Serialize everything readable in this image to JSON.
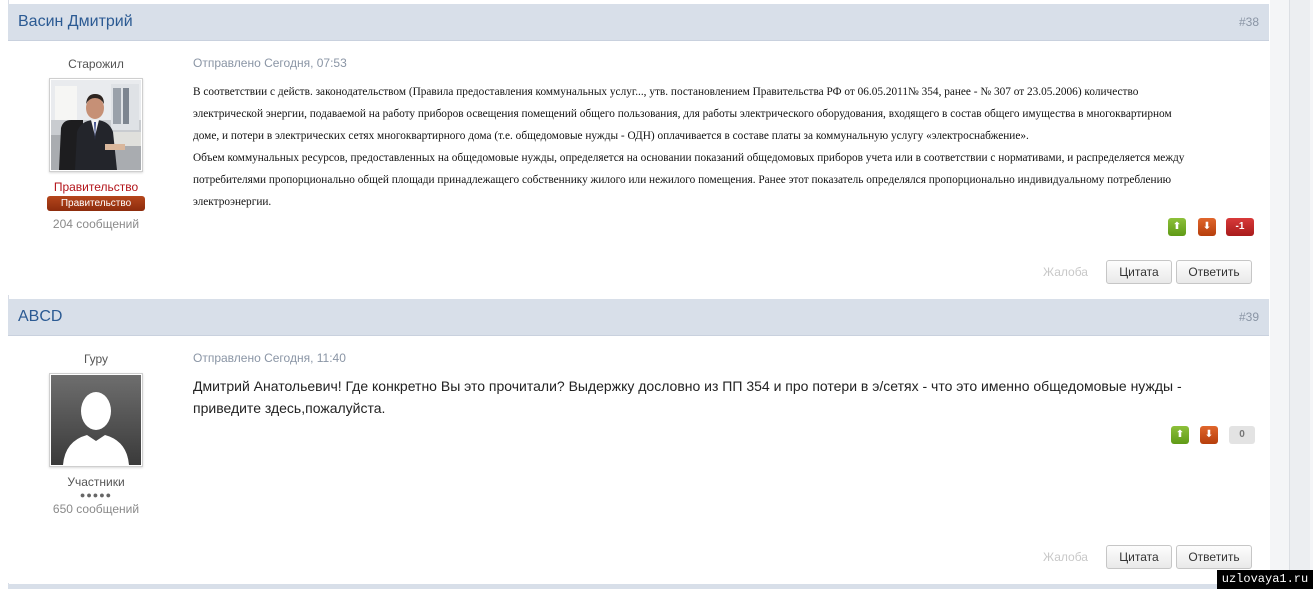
{
  "posts": [
    {
      "author": "Васин Дмитрий",
      "number": "#38",
      "rank_title": "Старожил",
      "group_name": "Правительство",
      "group_badge": "Правительство",
      "post_count": "204 сообщений",
      "date": "Отправлено Сегодня, 07:53",
      "body_lines": [
        "В соответствии с действ. законодательством  (Правила предоставления коммунальных услуг..., утв. постановлением Правительства РФ от 06.05.2011№ 354, ранее - № 307 от 23.05.2006) количество",
        "электрической энергии, подаваемой на работу приборов освещения помещений общего пользования, для работы электрического оборудования, входящего в состав общего имущества в многоквартирном",
        "доме, и потери в электрических сетях многоквартирного дома (т.е. общедомовые нужды - ОДН) оплачивается  в составе платы за коммунальную услугу «электроснабжение».",
        "Объем коммунальных ресурсов, предоставленных на общедомовые нужды, определяется на основании показаний общедомовых приборов учета или в соответствии с нормативами, и распределяется между",
        "потребителями пропорционально общей площади принадлежащего собственнику жилого или нежилого помещения. Ранее этот показатель определялся пропорционально индивидуальному потреблению",
        "электроэнергии."
      ],
      "reputation": "-1",
      "report_label": "Жалоба",
      "quote_label": "Цитата",
      "reply_label": "Ответить"
    },
    {
      "author": "ABCD",
      "number": "#39",
      "rank_title": "Гуру",
      "group_name": "Участники",
      "stars": "●●●●●",
      "post_count": "650 сообщений",
      "date": "Отправлено Сегодня, 11:40",
      "body_lines": [
        "Дмитрий Анатольевич! Где конкретно Вы это прочитали? Выдержку дословно из ПП 354 и про потери в э/сетях - что это именно общедомовые нужды -",
        "приведите здесь,пожалуйста."
      ],
      "reputation": "0",
      "report_label": "Жалоба",
      "quote_label": "Цитата",
      "reply_label": "Ответить"
    }
  ],
  "watermark": "uzlovaya1.ru",
  "colors": {
    "header_bg": "#d8dfe9",
    "author_link": "#2b5a93",
    "group_government": "#b3141a",
    "rep_up": "#6fac22",
    "rep_down": "#cc5018",
    "rep_negative": "#c42626"
  },
  "icons": {
    "rep_up": "arrow-up-icon",
    "rep_down": "arrow-down-icon"
  }
}
